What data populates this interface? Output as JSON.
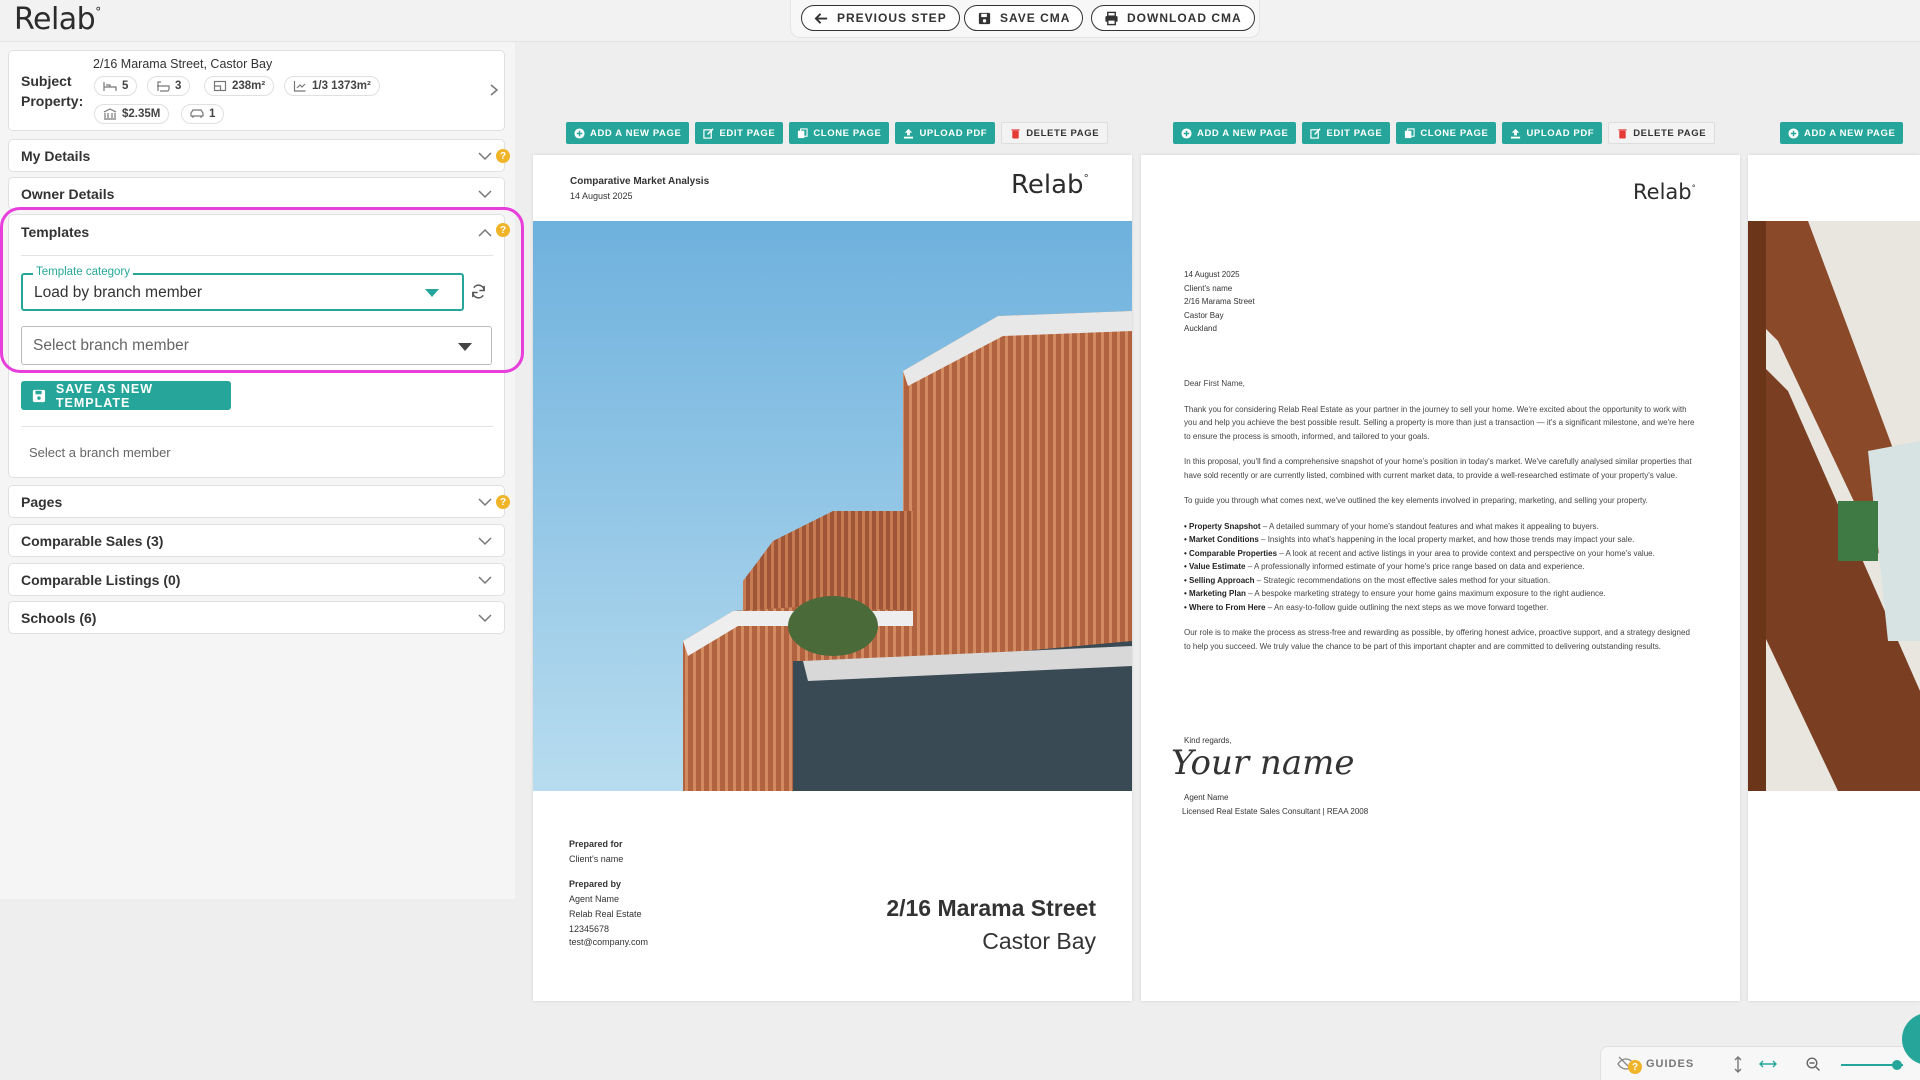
{
  "header": {
    "logo": "Relab",
    "prev_label": "PREVIOUS STEP",
    "save_label": "SAVE CMA",
    "download_label": "DOWNLOAD CMA"
  },
  "subject": {
    "label": "Subject Property:",
    "address": "2/16 Marama Street, Castor Bay",
    "beds": "5",
    "baths": "3",
    "floor_area": "238m²",
    "land": "1/3 1373m²",
    "value": "$2.35M",
    "garage": "1"
  },
  "sections": {
    "my_details": "My Details",
    "owner_details": "Owner Details",
    "templates": "Templates",
    "pages": "Pages",
    "comparable_sales": "Comparable Sales (3)",
    "comparable_listings": "Comparable Listings (0)",
    "schools": "Schools (6)"
  },
  "templates": {
    "category_legend": "Template category",
    "category_value": "Load by branch member",
    "member_placeholder": "Select branch member",
    "save_button": "SAVE AS NEW TEMPLATE",
    "helper": "Select a branch member"
  },
  "page_toolbar": {
    "add": "ADD A NEW PAGE",
    "edit": "EDIT PAGE",
    "clone": "CLONE PAGE",
    "upload": "UPLOAD PDF",
    "delete": "DELETE PAGE"
  },
  "cover": {
    "heading": "Comparative Market Analysis",
    "date": "14 August 2025",
    "logo": "Relab",
    "prepared_for_label": "Prepared for",
    "prepared_for": "Client's name",
    "prepared_by_label": "Prepared by",
    "agent": "Agent Name",
    "agency": "Relab Real Estate",
    "phone": "12345678",
    "email": "test@company.com",
    "street": "2/16 Marama Street",
    "suburb": "Castor Bay"
  },
  "letter": {
    "logo": "Relab",
    "address_lines": [
      "14 August 2025",
      "Client's name",
      "2/16 Marama Street",
      "Castor Bay",
      "Auckland"
    ],
    "greeting": "Dear First Name,",
    "p1": "Thank you for considering Relab Real Estate as your partner in the journey to sell your home. We're excited about the opportunity to work with you and help you achieve the best possible result. Selling a property is more than just a transaction — it's a significant milestone, and we're here to ensure the process is smooth, informed, and tailored to your goals.",
    "p2": "In this proposal, you'll find a comprehensive snapshot of your home's position in today's market. We've carefully analysed similar properties that have sold recently or are currently listed, combined with current market data, to provide a well-researched estimate of your property's value.",
    "p3": "To guide you through what comes next, we've outlined the key elements involved in preparing, marketing, and selling your property.",
    "bullets": [
      {
        "title": "Property Snapshot",
        "text": " – A detailed summary of your home's standout features and what makes it appealing to buyers."
      },
      {
        "title": "Market Conditions",
        "text": " – Insights into what's happening in the local property market, and how those trends may impact your sale."
      },
      {
        "title": "Comparable Properties",
        "text": " – A look at recent and active listings in your area to provide context and perspective on your home's value."
      },
      {
        "title": "Value Estimate",
        "text": " – A professionally informed estimate of your home's price range based on data and experience."
      },
      {
        "title": "Selling Approach",
        "text": " – Strategic recommendations on the most effective sales method for your situation."
      },
      {
        "title": "Marketing Plan",
        "text": " – A bespoke marketing strategy to ensure your home gains maximum exposure to the right audience."
      },
      {
        "title": "Where to From Here",
        "text": " – An easy-to-follow guide outlining the next steps as we move forward together."
      }
    ],
    "p4": "Our role is to make the process as stress-free and rewarding as possible, by offering honest advice, proactive support, and a strategy designed to help you succeed. We truly value the chance to be part of this important chapter and are committed to delivering outstanding results.",
    "signoff": "Kind regards,",
    "signature": "Your name",
    "agent": "Agent Name",
    "agent_title": "Licensed Real Estate Sales Consultant | REAA 2008"
  },
  "bottom": {
    "guides": "GUIDES",
    "zoom_level": 0.9
  },
  "colors": {
    "accent": "#26a69a",
    "highlight": "#e83edc",
    "help": "#f0b429"
  }
}
